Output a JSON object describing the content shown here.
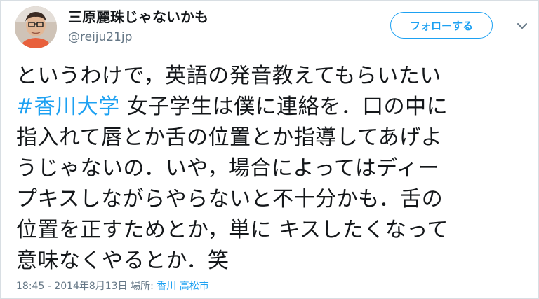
{
  "user": {
    "display_name": "三原麗珠じゃないかも",
    "handle": "@reiju21jp"
  },
  "follow_button": {
    "label": "フォローする"
  },
  "tweet": {
    "line1": "というわけで，英語の発音教えてもらいたい",
    "hashtag": "#香川大学",
    "line2_rest": " 女子学生は僕に連絡を．口の中に",
    "line3": "指入れて唇とか舌の位置とか指導してあげよ",
    "line4": "うじゃないの．いや，場合によってはディー",
    "line5": "プキスしながらやらないと不十分かも．舌の",
    "line6": "位置を正すためとか，単に キスしたくなって",
    "line7": "意味なくやるとか．笑"
  },
  "meta": {
    "timestamp": "18:45 - 2014年8月13日",
    "location_label": "場所:",
    "place": "香川 高松市"
  },
  "colors": {
    "accent": "#1da1f2",
    "text": "#14171a",
    "muted": "#657786"
  },
  "icons": {
    "caret": "chevron-down-icon",
    "avatar": "avatar"
  }
}
